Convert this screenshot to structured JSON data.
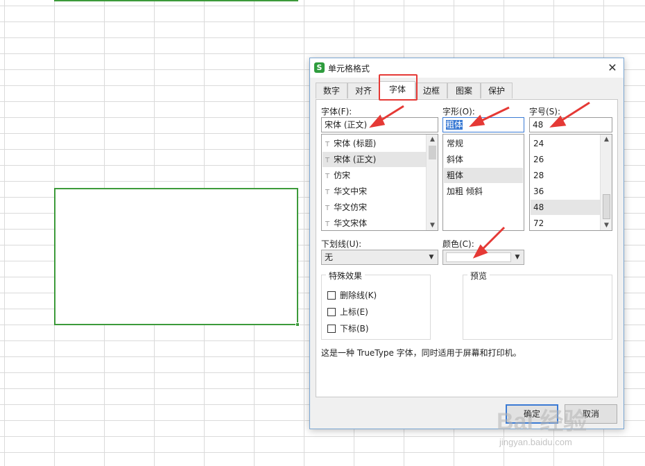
{
  "dialog": {
    "title": "单元格格式",
    "app_icon_glyph": "S",
    "close_glyph": "✕"
  },
  "tabs": [
    {
      "label": "数字"
    },
    {
      "label": "对齐"
    },
    {
      "label": "字体"
    },
    {
      "label": "边框"
    },
    {
      "label": "图案"
    },
    {
      "label": "保护"
    }
  ],
  "active_tab": "字体",
  "font": {
    "label": "字体(F):",
    "value": "宋体 (正文)",
    "items": [
      "宋体 (标题)",
      "宋体 (正文)",
      "仿宋",
      "华文中宋",
      "华文仿宋",
      "华文宋体"
    ],
    "selected": "宋体 (正文)",
    "item_icon": "truetype-font-icon"
  },
  "style": {
    "label": "字形(O):",
    "value": "粗体",
    "items": [
      "常规",
      "斜体",
      "粗体",
      "加粗 倾斜"
    ],
    "selected": "粗体"
  },
  "size": {
    "label": "字号(S):",
    "value": "48",
    "items": [
      "24",
      "26",
      "28",
      "36",
      "48",
      "72"
    ],
    "selected": "48"
  },
  "underline": {
    "label": "下划线(U):",
    "value": "无"
  },
  "color": {
    "label": "颜色(C):",
    "value_hex": "#ffffff"
  },
  "effects": {
    "title": "特殊效果",
    "items": [
      {
        "label": "删除线(K)",
        "checked": false
      },
      {
        "label": "上标(E)",
        "checked": false
      },
      {
        "label": "下标(B)",
        "checked": false
      }
    ]
  },
  "preview": {
    "title": "预览"
  },
  "description": "这是一种 TrueType 字体，同时适用于屏幕和打印机。",
  "buttons": {
    "ok": "确定",
    "cancel": "取消"
  },
  "watermark": {
    "text": "Bai 经验",
    "url": "jingyan.baidu.com"
  },
  "colors": {
    "selection_green": "#3c9a3a",
    "annotation_red": "#e53935",
    "app_icon_green": "#2e9c3d",
    "default_button_blue": "#3a7ad4"
  }
}
